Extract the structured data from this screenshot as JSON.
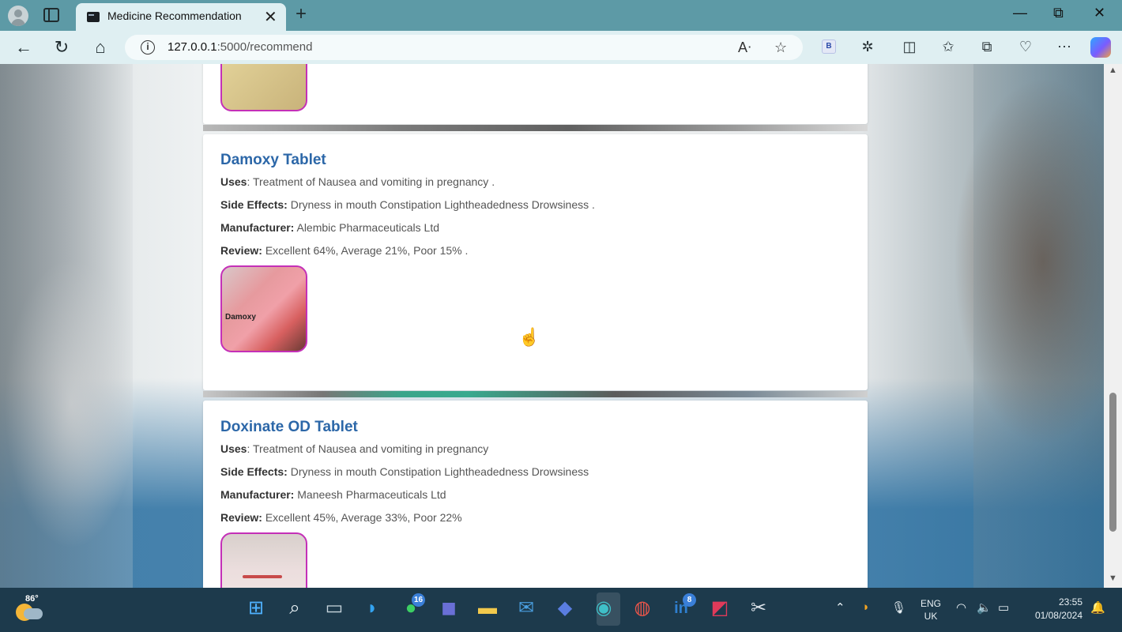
{
  "browser": {
    "tab_title": "Medicine Recommendation",
    "url_host": "127.0.0.1",
    "url_path": ":5000/recommend",
    "new_tab_symbol": "+",
    "close_symbol": "✕"
  },
  "labels": {
    "uses": "Uses",
    "side_effects": "Side Effects:",
    "manufacturer": "Manufacturer:",
    "review": "Review:"
  },
  "medicines": [
    {
      "name": "Damoxy Tablet",
      "uses": ": Treatment of Nausea and vomiting in pregnancy .",
      "side_effects": "Dryness in mouth Constipation Lightheadedness Drowsiness .",
      "manufacturer": "Alembic Pharmaceuticals Ltd",
      "review": "Excellent 64%, Average 21%, Poor 15% .",
      "image_text": "Damoxy"
    },
    {
      "name": "Doxinate OD Tablet",
      "uses": ": Treatment of Nausea and vomiting in pregnancy",
      "side_effects": "Dryness in mouth Constipation Lightheadedness Drowsiness",
      "manufacturer": "Maneesh Pharmaceuticals Ltd",
      "review": "Excellent 45%, Average 33%, Poor 22%"
    }
  ],
  "taskbar": {
    "weather_temp": "86°",
    "whatsapp_badge": "16",
    "linkedin_badge": "8",
    "lang_line1": "ENG",
    "lang_line2": "UK",
    "time": "23:55",
    "date": "01/08/2024"
  },
  "colors": {
    "accent_title": "#2c67a8",
    "image_border": "#c430b8",
    "browser_frame": "#5d9aa6"
  }
}
